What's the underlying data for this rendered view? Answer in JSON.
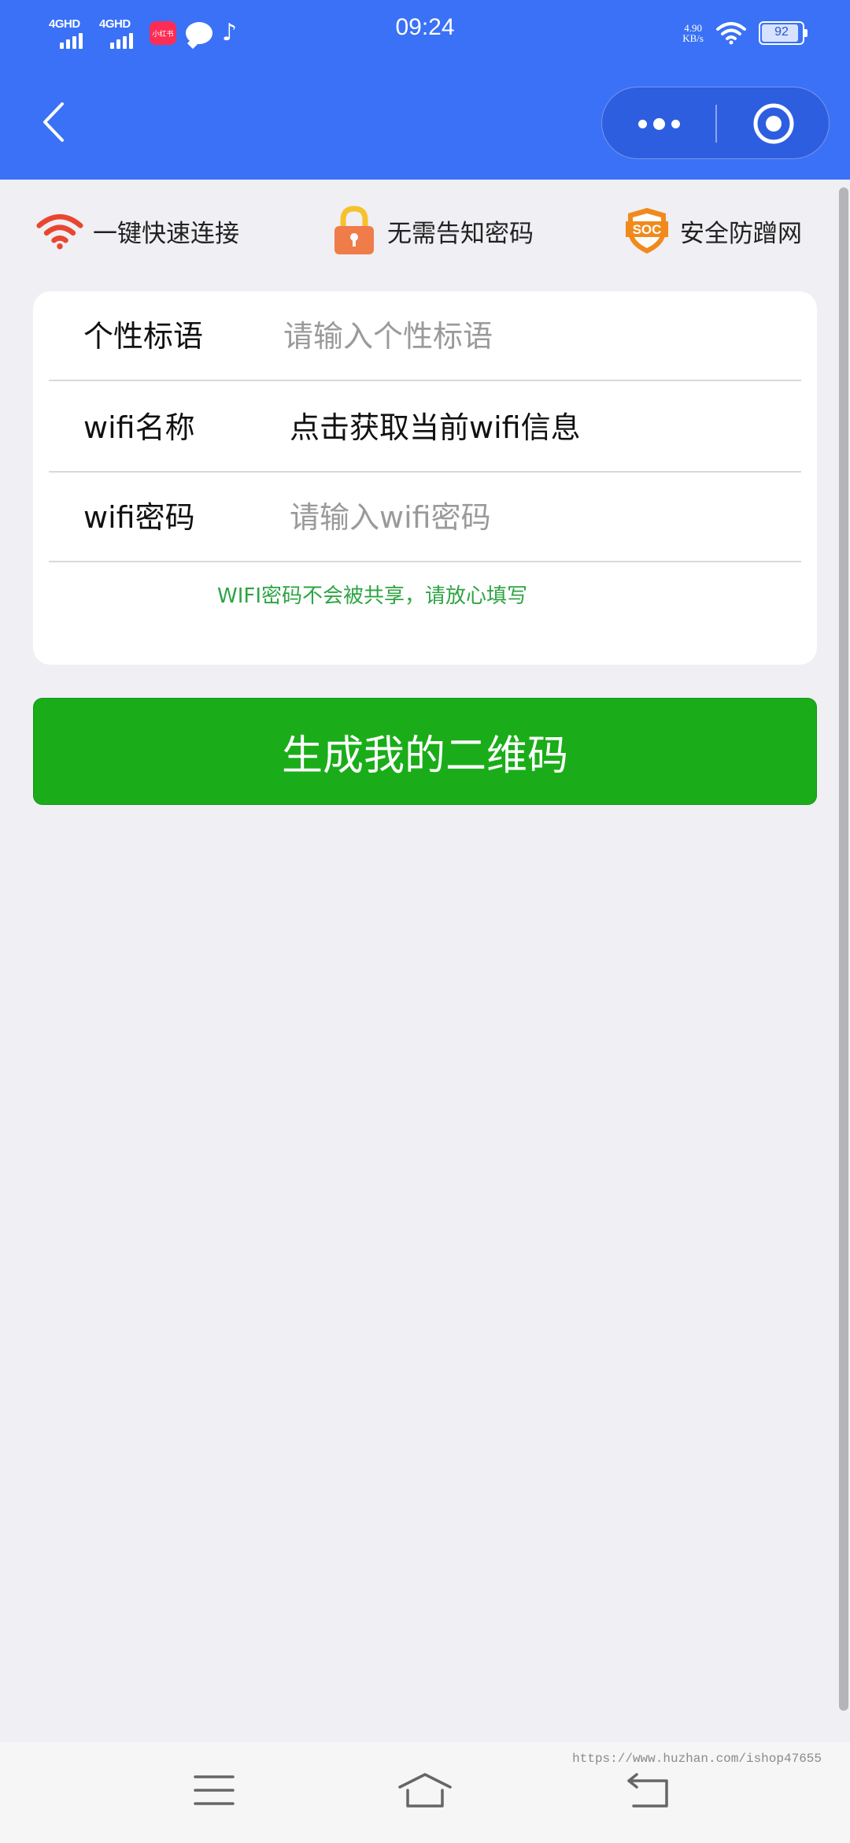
{
  "status_bar": {
    "network1": "4GHD",
    "network2": "4GHD",
    "app_badge": "小红书",
    "time": "09:24",
    "speed_value": "4.90",
    "speed_unit": "KB/s",
    "battery": "92",
    "battery_level": 0.92
  },
  "nav": {
    "back_icon": "chevron-left-icon",
    "more_icon": "more-dots-icon",
    "close_icon": "target-circle-icon"
  },
  "features": [
    {
      "label": "一键快速连接",
      "icon": "wifi-icon",
      "color": "#e8462f"
    },
    {
      "label": "无需告知密码",
      "icon": "lock-icon",
      "color": "#f07c4a"
    },
    {
      "label": "安全防蹭网",
      "icon": "soc-shield-icon",
      "color": "#f08a1c"
    }
  ],
  "form": {
    "slogan_label": "个性标语",
    "slogan_placeholder": "请输入个性标语",
    "wifi_name_label": "wifi名称",
    "wifi_name_value": "点击获取当前wifi信息",
    "wifi_password_label": "wifi密码",
    "wifi_password_placeholder": "请输入wifi密码",
    "hint": "WIFI密码不会被共享，请放心填写"
  },
  "button": {
    "generate_label": "生成我的二维码"
  },
  "bottom_nav": {
    "menu_icon": "menu-icon",
    "home_icon": "home-icon",
    "back_icon": "return-icon",
    "watermark": "https://www.huzhan.com/ishop47655"
  },
  "colors": {
    "header": "#3a71f6",
    "button": "#1aad19",
    "hint": "#2ea443",
    "background": "#efeff4"
  }
}
